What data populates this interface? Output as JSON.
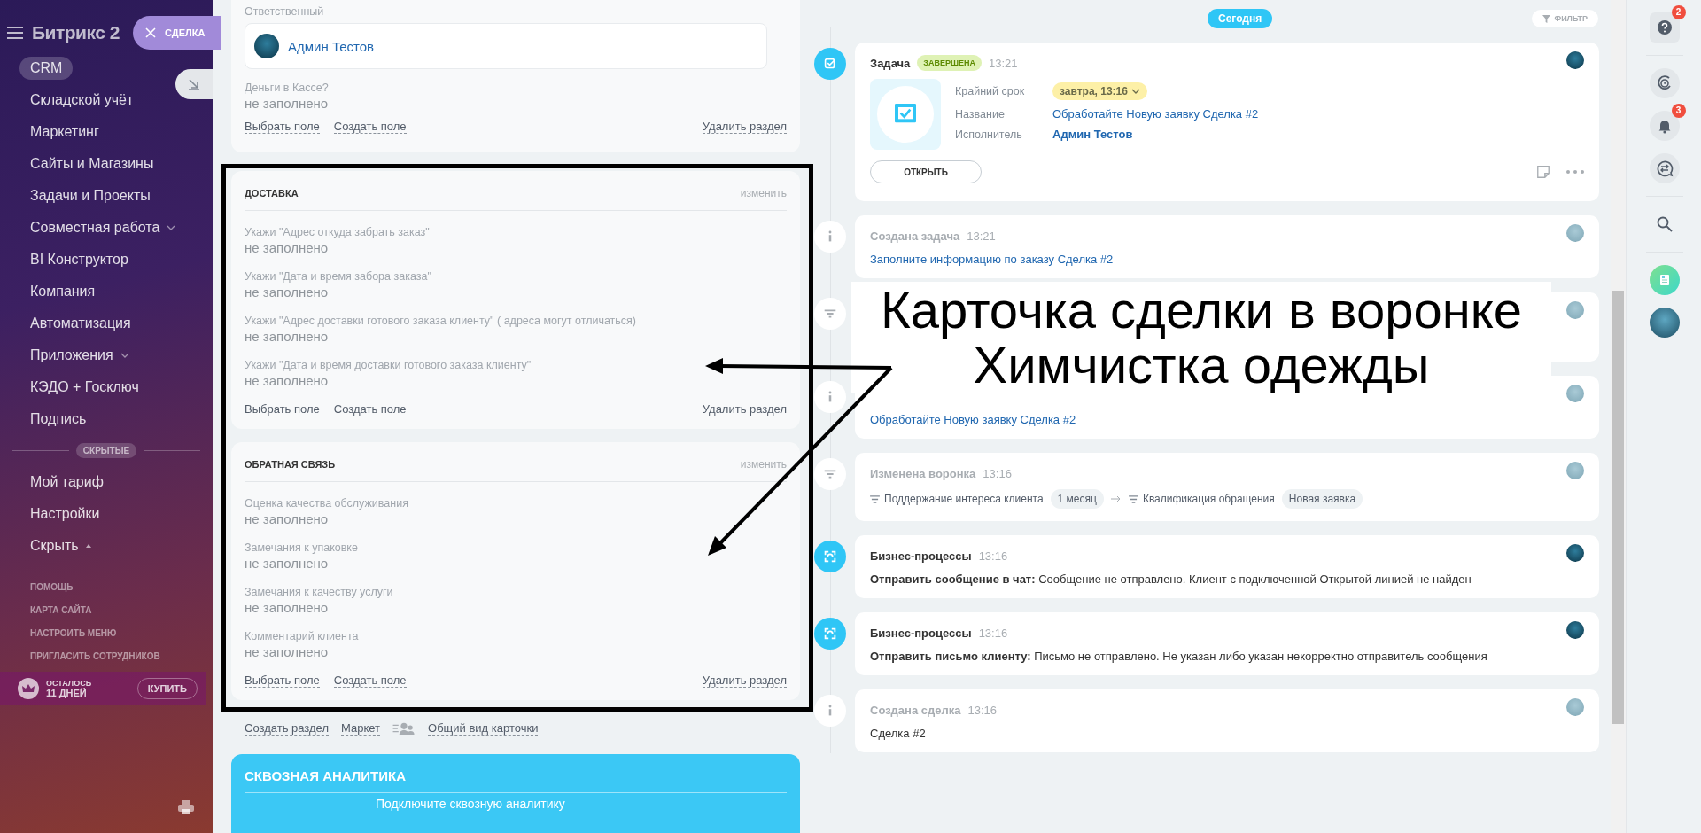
{
  "sidebar": {
    "logo": "Битрикс 2",
    "menu": [
      {
        "label": "CRM",
        "selected": true,
        "submenu": false
      },
      {
        "label": "Складской учёт",
        "selected": false,
        "submenu": false
      },
      {
        "label": "Маркетинг",
        "selected": false,
        "submenu": false
      },
      {
        "label": "Сайты и Магазины",
        "selected": false,
        "submenu": false
      },
      {
        "label": "Задачи и Проекты",
        "selected": false,
        "submenu": false
      },
      {
        "label": "Совместная работа",
        "selected": false,
        "submenu": true
      },
      {
        "label": "BI Конструктор",
        "selected": false,
        "submenu": false
      },
      {
        "label": "Компания",
        "selected": false,
        "submenu": false
      },
      {
        "label": "Автоматизация",
        "selected": false,
        "submenu": false
      },
      {
        "label": "Приложения",
        "selected": false,
        "submenu": true
      },
      {
        "label": "КЭДО + Госключ",
        "selected": false,
        "submenu": false
      },
      {
        "label": "Подпись",
        "selected": false,
        "submenu": false
      }
    ],
    "hidden_label": "СКРЫТЫЕ",
    "more_menu": [
      {
        "label": "Мой тариф",
        "toggle": false
      },
      {
        "label": "Настройки",
        "toggle": false
      },
      {
        "label": "Скрыть",
        "toggle": true
      }
    ],
    "links": [
      "ПОМОЩЬ",
      "КАРТА САЙТА",
      "НАСТРОИТЬ МЕНЮ",
      "ПРИГЛАСИТЬ СОТРУДНИКОВ"
    ],
    "trial": {
      "label": "ОСТАЛОСЬ",
      "days": "11 ДНЕЙ",
      "button": "КУПИТЬ"
    }
  },
  "slider_tab": {
    "label": "СДЕЛКА"
  },
  "details": {
    "top_section": {
      "responsible_label": "Ответственный",
      "responsible": "Админ Тестов",
      "fields": [
        {
          "label": "Деньги в Кассе?",
          "value": "не заполнено"
        }
      ],
      "actions": [
        "Выбрать поле",
        "Создать поле"
      ],
      "delete": "Удалить раздел"
    },
    "sections": [
      {
        "title": "ДОСТАВКА",
        "edit": "изменить",
        "fields": [
          {
            "label": "Укажи \"Адрес откуда забрать заказ\"",
            "value": "не заполнено"
          },
          {
            "label": "Укажи \"Дата и время забора заказа\"",
            "value": "не заполнено"
          },
          {
            "label": "Укажи \"Адрес доставки готового заказа клиенту\" ( адреса могут отличаться)",
            "value": "не заполнено"
          },
          {
            "label": "Укажи \"Дата и время доставки готового заказа клиенту\"",
            "value": "не заполнено"
          }
        ],
        "actions": [
          "Выбрать поле",
          "Создать поле"
        ],
        "delete": "Удалить раздел"
      },
      {
        "title": "ОБРАТНАЯ СВЯЗЬ",
        "edit": "изменить",
        "fields": [
          {
            "label": "Оценка качества обслуживания",
            "value": "не заполнено"
          },
          {
            "label": "Замечания к упаковке",
            "value": "не заполнено"
          },
          {
            "label": "Замечания к качеству услуги",
            "value": "не заполнено"
          },
          {
            "label": "Комментарий клиента",
            "value": "не заполнено"
          }
        ],
        "actions": [
          "Выбрать поле",
          "Создать поле"
        ],
        "delete": "Удалить раздел"
      }
    ],
    "bottom_links": [
      "Создать раздел",
      "Маркет",
      "Общий вид карточки"
    ],
    "analytics": {
      "title": "СКВОЗНАЯ АНАЛИТИКА",
      "text": "Подключите сквозную аналитику"
    }
  },
  "timeline": {
    "today": "Сегодня",
    "filter": "ФИЛЬТР",
    "items": [
      {
        "kind": "task",
        "title": "Задача",
        "status": "ЗАВЕРШЕНА",
        "time": "13:21",
        "fields": [
          {
            "label": "Крайний срок",
            "value": "завтра, 13:16",
            "kind": "pill"
          },
          {
            "label": "Название",
            "value": "Обработайте Новую заявку Сделка #2",
            "kind": "link"
          },
          {
            "label": "Исполнитель",
            "value": "Админ Тестов",
            "kind": "person"
          }
        ],
        "button": "ОТКРЫТЬ"
      },
      {
        "kind": "info",
        "title": "Создана задача",
        "time": "13:21",
        "link": "Заполните информацию по заказу Сделка #2"
      },
      {
        "kind": "funnel"
      },
      {
        "kind": "info",
        "link": "Обработайте Новую заявку Сделка #2"
      },
      {
        "kind": "funnel",
        "title": "Изменена воронка",
        "time": "13:16",
        "stages": [
          {
            "name": "Поддержание интереса клиента",
            "tag": "1 месяц"
          },
          {
            "name": "Квалификация обращения",
            "tag": "Новая заявка"
          }
        ]
      },
      {
        "kind": "process",
        "title": "Бизнес-процессы",
        "time": "13:16",
        "text": "**Отправить сообщение в чат:** Сообщение не отправлено. Клиент с подключенной Открытой линией не найден"
      },
      {
        "kind": "process",
        "title": "Бизнес-процессы",
        "time": "13:16",
        "text": "**Отправить письмо клиенту:** Письмо не отправлено. Не указан либо указан некорректно отправитель сообщения"
      },
      {
        "kind": "info",
        "title": "Создана сделка",
        "time": "13:16",
        "text": "Сделка #2"
      }
    ]
  },
  "right_bar": [
    {
      "kind": "help",
      "badge": "2"
    },
    {
      "kind": "timeman"
    },
    {
      "kind": "notifications",
      "badge": "3"
    },
    {
      "kind": "chat"
    },
    {
      "kind": "search"
    },
    {
      "kind": "app"
    },
    {
      "kind": "avatar"
    }
  ],
  "annotation": {
    "lines": [
      "Карточка сделки в воронке",
      "Химчистка одежды"
    ]
  }
}
